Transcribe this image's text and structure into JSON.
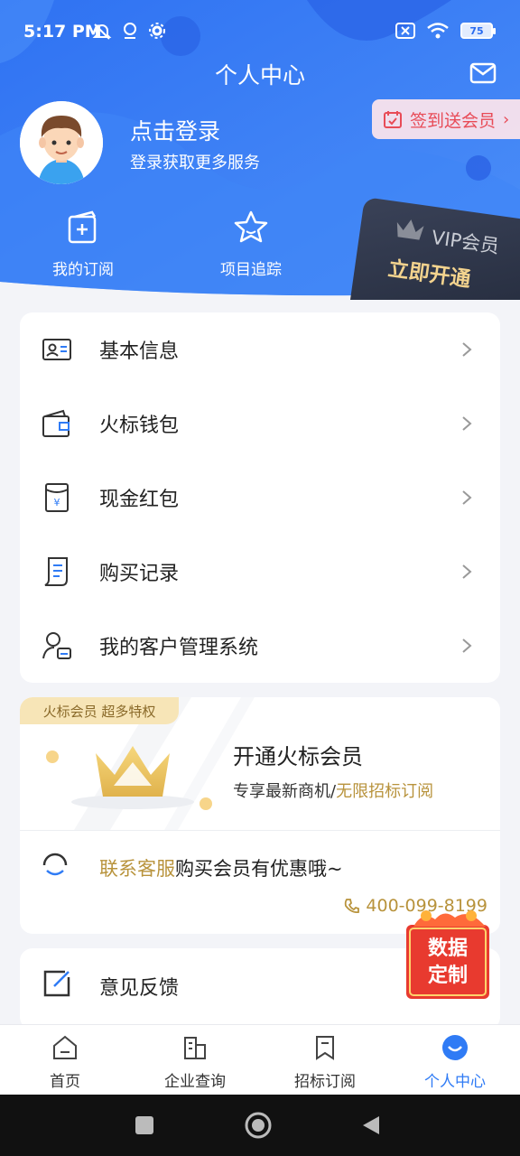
{
  "status": {
    "time": "5:17 PM",
    "battery": "75"
  },
  "header": {
    "title": "个人中心",
    "checkin": "签到送会员",
    "login_title": "点击登录",
    "login_sub": "登录获取更多服务",
    "quick": [
      {
        "label": "我的订阅",
        "icon": "subscribe-icon"
      },
      {
        "label": "项目追踪",
        "icon": "star-icon"
      }
    ],
    "vip": {
      "title": "VIP会员",
      "action": "立即开通"
    }
  },
  "menu": [
    {
      "label": "基本信息",
      "icon": "id-card-icon"
    },
    {
      "label": "火标钱包",
      "icon": "wallet-icon"
    },
    {
      "label": "现金红包",
      "icon": "red-packet-icon"
    },
    {
      "label": "购买记录",
      "icon": "receipt-icon"
    },
    {
      "label": "我的客户管理系统",
      "icon": "customer-manage-icon"
    }
  ],
  "member": {
    "tag": "火标会员 超多特权",
    "title": "开通火标会员",
    "sub_plain": "专享最新商机/",
    "sub_highlight": "无限招标订阅",
    "service_highlight": "联系客服",
    "service_plain": "购买会员有优惠哦~",
    "phone": "400-099-8199"
  },
  "feedback": {
    "label": "意见反馈"
  },
  "float_badge": {
    "line1": "数据",
    "line2": "定制"
  },
  "tabs": [
    {
      "label": "首页",
      "icon": "home-icon",
      "active": false
    },
    {
      "label": "企业查询",
      "icon": "building-icon",
      "active": false
    },
    {
      "label": "招标订阅",
      "icon": "bookmark-icon",
      "active": false
    },
    {
      "label": "个人中心",
      "icon": "profile-icon",
      "active": true
    }
  ],
  "colors": {
    "accent": "#2f7bf5",
    "gold": "#b8933c",
    "header": "#3b7df5"
  }
}
